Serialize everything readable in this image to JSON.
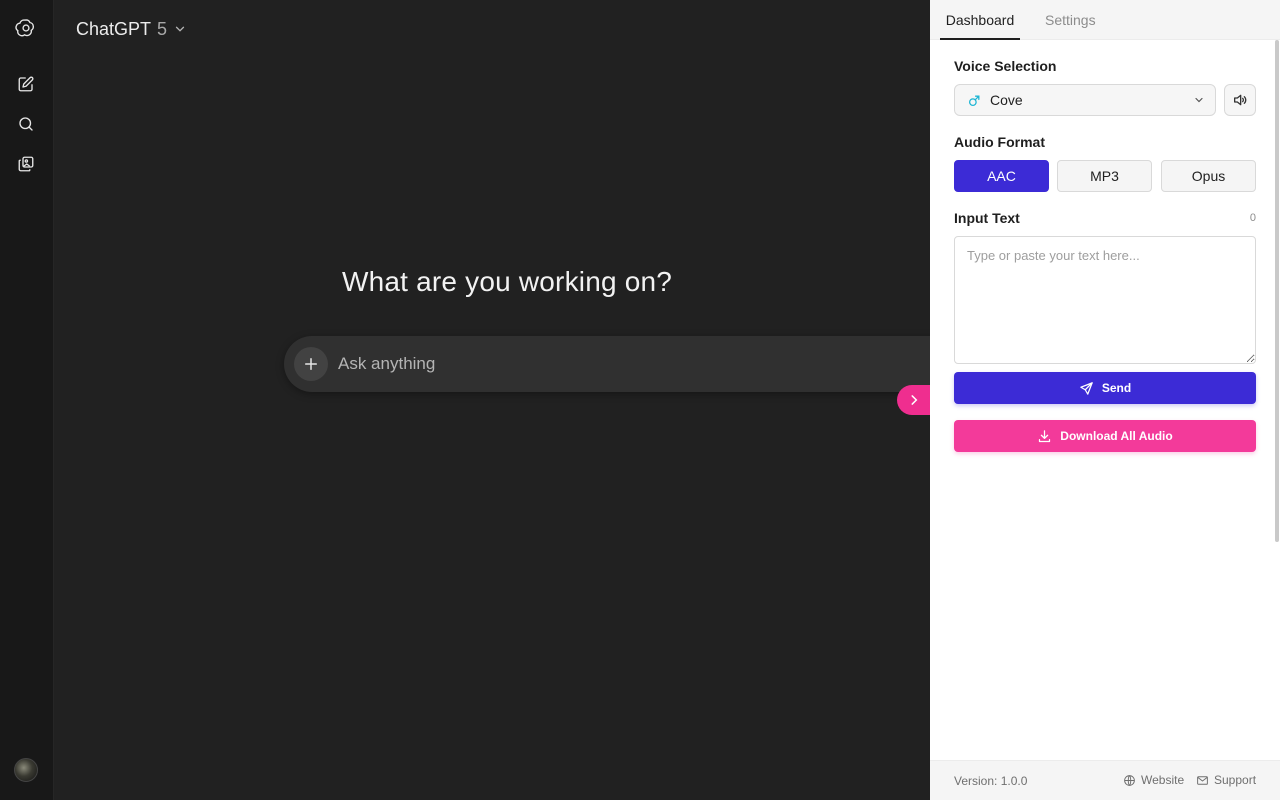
{
  "app": {
    "model_name": "ChatGPT",
    "model_version": "5"
  },
  "sidebar": {
    "icons": [
      "openai-logo-icon",
      "new-chat-icon",
      "search-icon",
      "library-icon"
    ]
  },
  "main": {
    "headline": "What are you working on?",
    "composer_placeholder": "Ask anything"
  },
  "panel": {
    "tabs": [
      {
        "label": "Dashboard",
        "active": true
      },
      {
        "label": "Settings",
        "active": false
      }
    ],
    "voice_label": "Voice Selection",
    "voice_value": "Cove",
    "voice_gender_symbol": "♂",
    "audio_format_label": "Audio Format",
    "formats": [
      {
        "label": "AAC",
        "active": true
      },
      {
        "label": "MP3",
        "active": false
      },
      {
        "label": "Opus",
        "active": false
      }
    ],
    "input_label": "Input Text",
    "char_count": "0",
    "input_placeholder": "Type or paste your text here...",
    "send_label": "Send",
    "download_label": "Download All Audio",
    "footer": {
      "version": "Version: 1.0.0",
      "website": "Website",
      "support": "Support"
    },
    "colors": {
      "primary": "#3c2bd6",
      "accent": "#f33a9a",
      "gender_icon": "#1fb6d4"
    }
  }
}
